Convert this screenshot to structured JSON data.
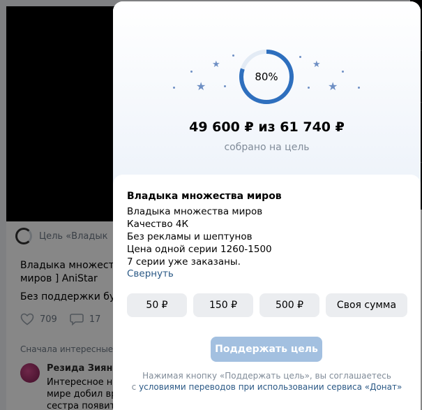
{
  "background": {
    "goal_row_text": "Цель «Владык",
    "post_text_line1": "Владыка множеств",
    "post_text_line2": "миров ] AniStar",
    "post_text_line3": "Без поддержки буде",
    "likes": "709",
    "comments": "17",
    "sort_label": "Сначала интересные",
    "comment_author": "Резида Зиянбер",
    "comment_line1": "Интересное нач",
    "comment_line2": "мире добил вро",
    "comment_line3": "сестра появится типа бога Дьявола, она изначально ее была 😂😂😂 во"
  },
  "modal": {
    "progress_percent": 80,
    "progress_label": "80%",
    "amount_collected": "49 600 ₽",
    "amount_separator": "из",
    "amount_goal": "61 740 ₽",
    "amount_subtitle": "собрано на цель",
    "goal_title": "Владыка множества миров",
    "description": [
      "Владыка множества миров",
      "Качество 4К",
      "Без рекламы и шептунов",
      "Цена одной серии 1260-1500",
      "7 серии уже заказаны."
    ],
    "collapse_label": "Свернуть",
    "amount_options": [
      "50 ₽",
      "150 ₽",
      "500 ₽"
    ],
    "custom_amount_label": "Своя сумма",
    "support_button_label": "Поддержать цель",
    "legal_line1": "Нажимая кнопку «Поддержать цель», вы соглашаетесь",
    "legal_prefix": "с ",
    "legal_link": "условиями переводов при использовании сервиса «Донат»",
    "progress_color": "#2e6fbe",
    "track_color": "#e3ebf5",
    "accent_color": "#2a5885"
  }
}
